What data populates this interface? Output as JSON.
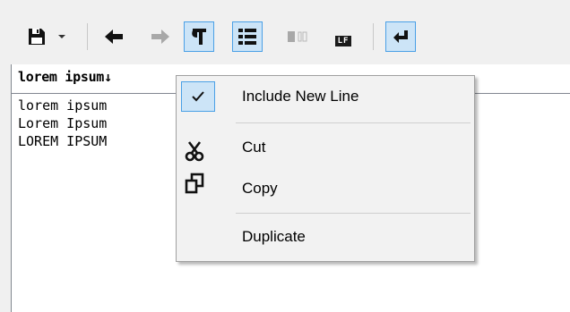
{
  "toolbar": {
    "buttons": [
      {
        "name": "save-button",
        "icon": "floppy-disk-icon"
      },
      {
        "name": "save-dropdown-button",
        "icon": "chevron-down-icon"
      },
      {
        "name": "back-button",
        "icon": "arrow-left-icon"
      },
      {
        "name": "forward-button",
        "icon": "arrow-right-icon"
      },
      {
        "name": "show-formatting-button",
        "icon": "pilcrow-icon",
        "checked": true
      },
      {
        "name": "list-view-button",
        "icon": "list-icon",
        "checked": true
      },
      {
        "name": "column-view-button",
        "icon": "column-view-icon"
      },
      {
        "name": "line-ending-button",
        "icon": "lf-icon"
      },
      {
        "name": "word-wrap-button",
        "icon": "return-arrow-icon",
        "checked": true
      }
    ],
    "lf_badge": "LF"
  },
  "editor": {
    "header_text": "lorem ipsum↓",
    "lines": [
      "lorem ipsum",
      "Lorem Ipsum",
      "LOREM IPSUM"
    ]
  },
  "context_menu": {
    "include_new_line": {
      "label": "Include New Line",
      "checked": true,
      "icon": "checkmark-icon"
    },
    "cut": {
      "label": "Cut",
      "icon": "scissors-icon"
    },
    "copy": {
      "label": "Copy",
      "icon": "copy-icon"
    },
    "duplicate": {
      "label": "Duplicate"
    }
  },
  "colors": {
    "checked_bg": "#cce4f7",
    "checked_border": "#4aa0e6",
    "menu_bg": "#f2f2f2"
  }
}
